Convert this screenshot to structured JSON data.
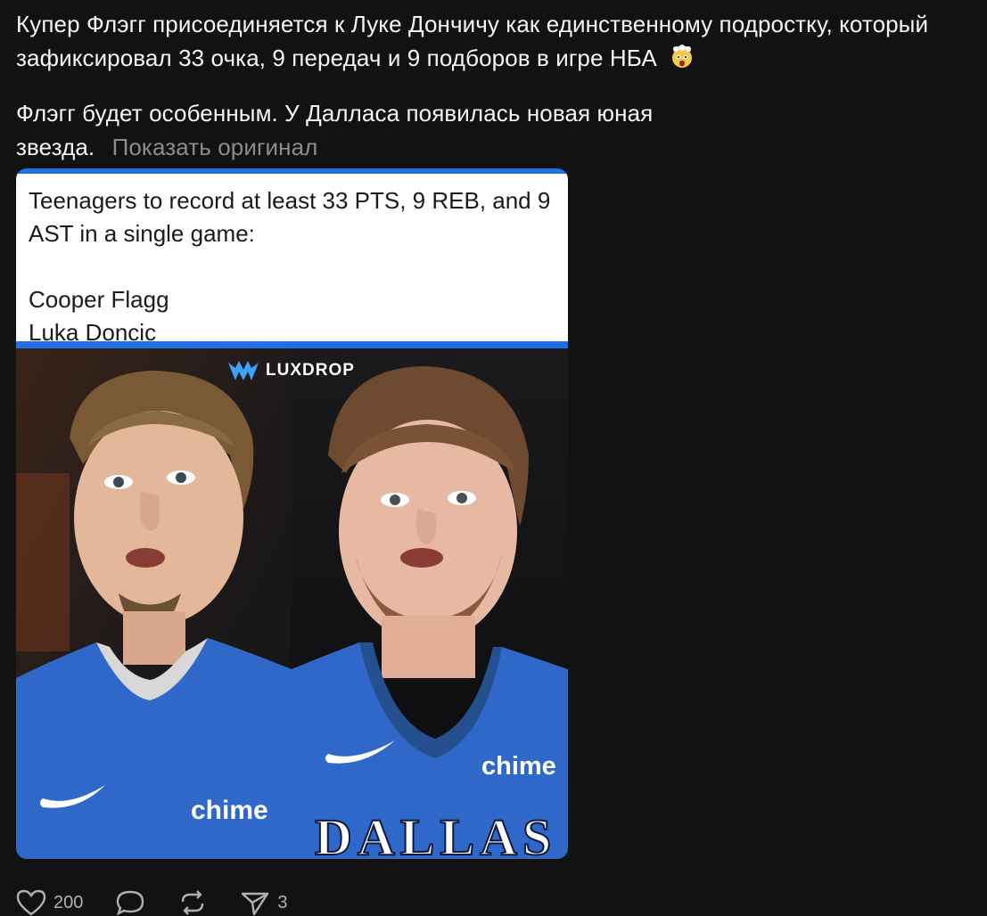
{
  "post": {
    "text_line1": "Купер Флэгг присоединяется к Луке Дончичу как единственному подростку, который зафиксировал 33 очка, 9 передач и 9 подборов в игре НБА",
    "emoji_icon": "exploding-head-emoji",
    "text_line2": "Флэгг будет особенным. У Далласа появилась новая юная звезда.",
    "show_original": "Показать оригинал"
  },
  "media": {
    "card_title": "Teenagers to record at least 33 PTS, 9 REB, and 9 AST in a single game:",
    "names": [
      "Cooper Flagg",
      "Luka Doncic"
    ],
    "logo_text": "LUXDROP",
    "sponsor_left": "chime",
    "sponsor_right": "chime",
    "jersey_text": "DALLAS",
    "accent_color": "#1f6feb",
    "jersey_color": "#2f68c8"
  },
  "actions": {
    "like_count": "200",
    "share_count": "3",
    "icons": [
      "heart-icon",
      "comment-icon",
      "repost-icon",
      "send-icon"
    ]
  }
}
